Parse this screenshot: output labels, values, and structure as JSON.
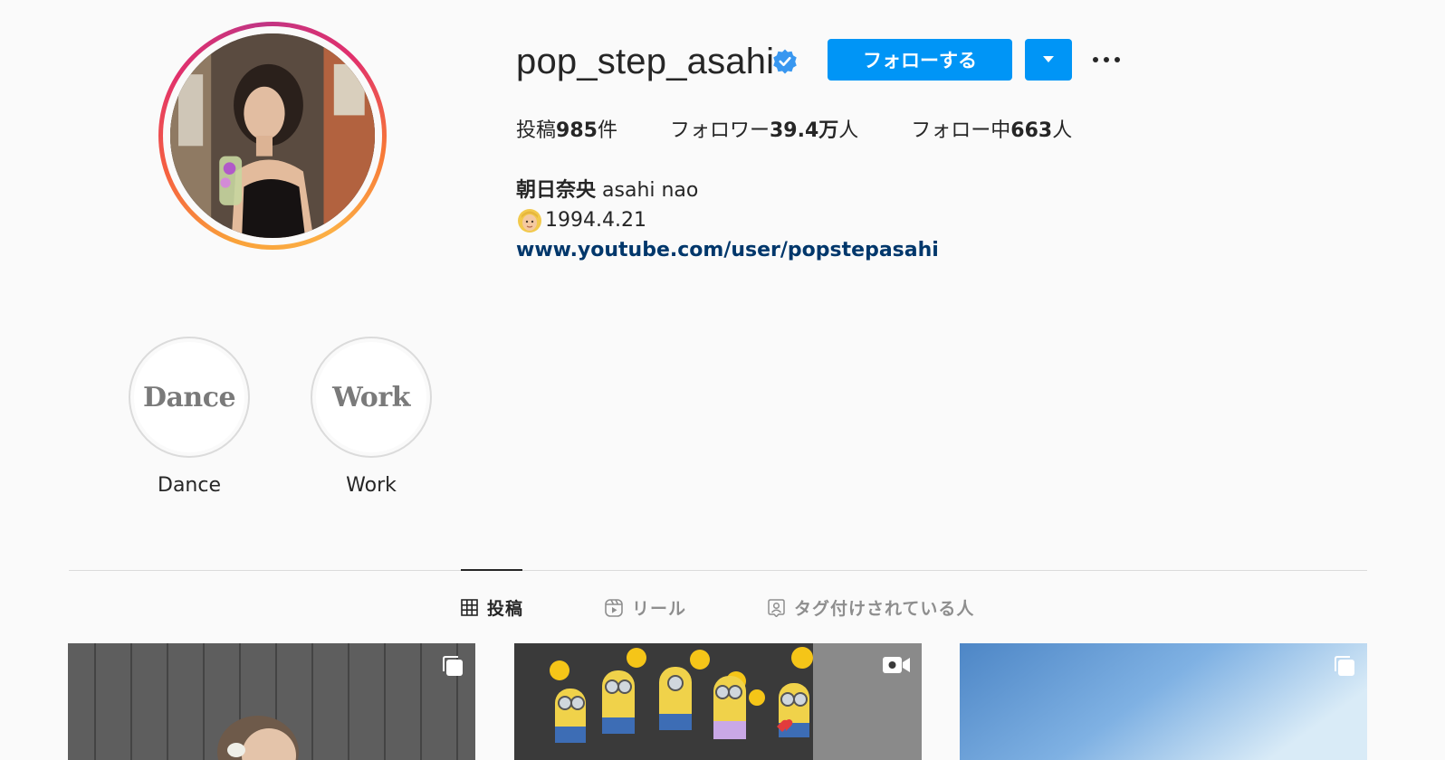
{
  "profile": {
    "username": "pop_step_asahi",
    "follow_label": "フォローする",
    "stats": {
      "posts_prefix": "投稿",
      "posts_count": "985",
      "posts_suffix": "件",
      "followers_prefix": "フォロワー",
      "followers_count": "39.4万",
      "followers_suffix": "人",
      "following_prefix": "フォロー中",
      "following_count": "663",
      "following_suffix": "人"
    },
    "bio": {
      "name_jp": "朝日奈央",
      "name_en": "asahi nao",
      "birthday": "1994.4.21",
      "link": "www.youtube.com/user/popstepasahi"
    }
  },
  "highlights": [
    {
      "cover_text": "Dance",
      "label": "Dance"
    },
    {
      "cover_text": "Work",
      "label": "Work"
    }
  ],
  "tabs": [
    {
      "label": "投稿",
      "icon": "grid-icon",
      "active": true
    },
    {
      "label": "リール",
      "icon": "reels-icon",
      "active": false
    },
    {
      "label": "タグ付けされている人",
      "icon": "tagged-icon",
      "active": false
    }
  ],
  "posts": [
    {
      "type": "carousel",
      "icon": "carousel-icon"
    },
    {
      "type": "video",
      "icon": "video-icon"
    },
    {
      "type": "carousel",
      "icon": "carousel-icon"
    }
  ],
  "colors": {
    "accent": "#0095f6",
    "link": "#00376b",
    "verified": "#3897f0"
  }
}
